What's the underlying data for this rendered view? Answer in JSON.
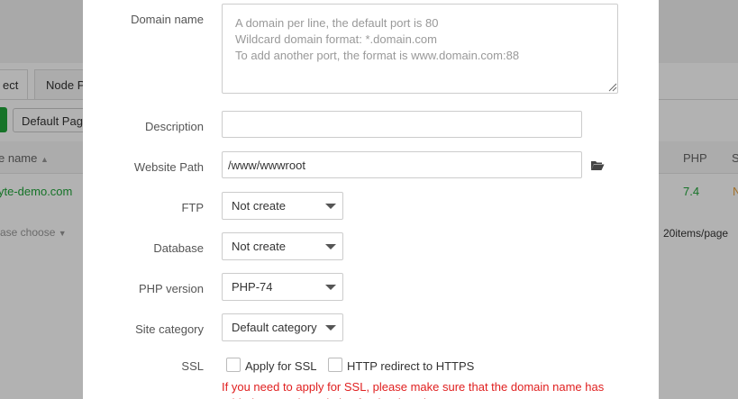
{
  "background": {
    "tabs": [
      "ect",
      "Node P"
    ],
    "default_page_button": "Default Pag",
    "columns": [
      "e name",
      "PHP",
      "S"
    ],
    "row": {
      "site": "yte-demo.com",
      "php": "7.4",
      "extra": "N"
    },
    "pager_select": "ase choose",
    "pager_text": "20items/page"
  },
  "form": {
    "domain": {
      "label": "Domain name",
      "placeholder": "A domain per line, the default port is 80\nWildcard domain format: *.domain.com\nTo add another port, the format is www.domain.com:88"
    },
    "description": {
      "label": "Description",
      "value": ""
    },
    "website_path": {
      "label": "Website Path",
      "value": "/www/wwwroot"
    },
    "ftp": {
      "label": "FTP",
      "selected": "Not create"
    },
    "database": {
      "label": "Database",
      "selected": "Not create"
    },
    "php_version": {
      "label": "PHP version",
      "selected": "PHP-74"
    },
    "site_category": {
      "label": "Site category",
      "selected": "Default category"
    },
    "ssl": {
      "label": "SSL",
      "apply_label": "Apply for SSL",
      "redirect_label": "HTTP redirect to HTTPS",
      "warning": "If you need to apply for SSL, please make sure that the domain name has added A record resolution for the domain name"
    }
  },
  "colors": {
    "accent_green": "#20a53a",
    "warning_red": "#e02020",
    "link_green": "#20a53a"
  }
}
